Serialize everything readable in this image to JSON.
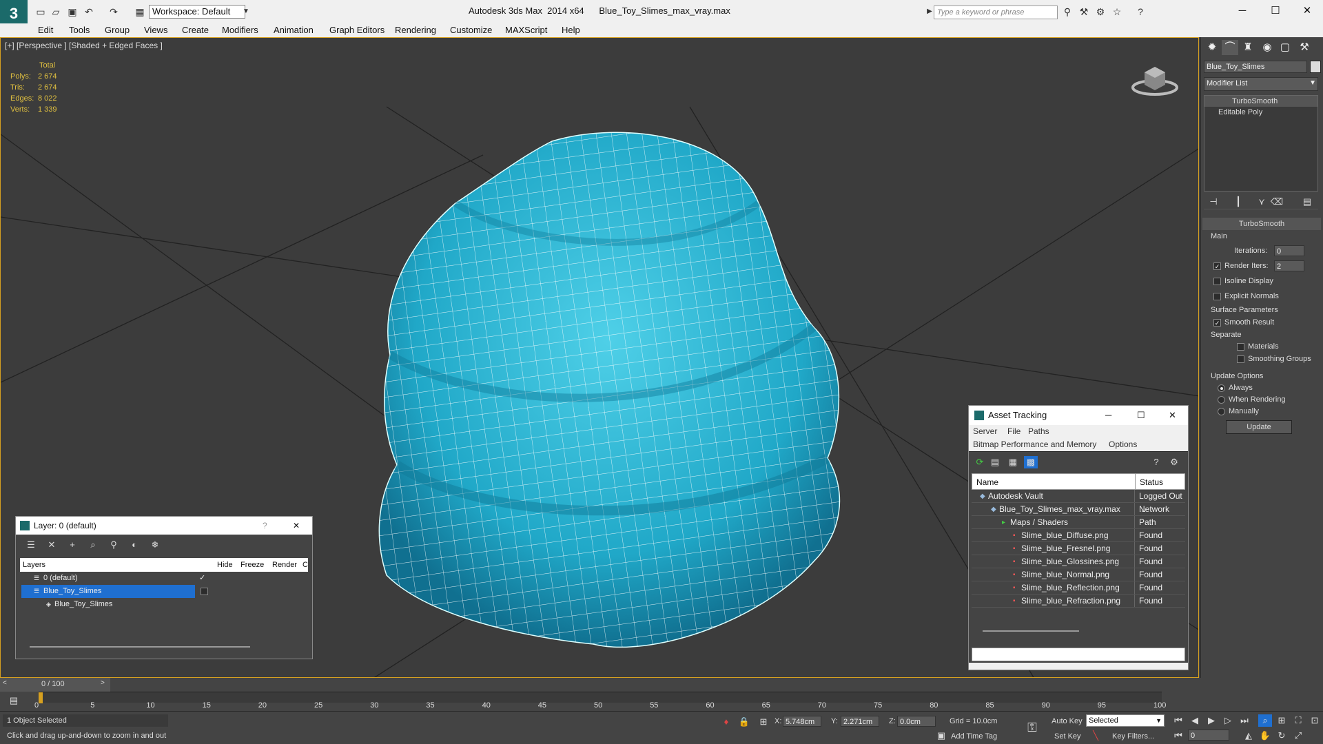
{
  "titlebar": {
    "app_title": "Autodesk 3ds Max  2014 x64",
    "file_name": "Blue_Toy_Slimes_max_vray.max",
    "workspace_label": "Workspace: Default",
    "search_placeholder": "Type a keyword or phrase"
  },
  "menu": [
    "Edit",
    "Tools",
    "Group",
    "Views",
    "Create",
    "Modifiers",
    "Animation",
    "Graph Editors",
    "Rendering",
    "Customize",
    "MAXScript",
    "Help"
  ],
  "viewport": {
    "label": "[+] [Perspective ] [Shaded + Edged Faces ]",
    "stats_header": "Total",
    "stats": [
      {
        "label": "Polys:",
        "value": "2 674"
      },
      {
        "label": "Tris:",
        "value": "2 674"
      },
      {
        "label": "Edges:",
        "value": "8 022"
      },
      {
        "label": "Verts:",
        "value": "1 339"
      }
    ],
    "mesh_color": "#2ab4d0"
  },
  "command_panel": {
    "object_name": "Blue_Toy_Slimes",
    "modifier_list_label": "Modifier List",
    "stack": [
      "TurboSmooth",
      "Editable Poly"
    ],
    "rollout_title": "TurboSmooth",
    "main_label": "Main",
    "iterations_label": "Iterations:",
    "iterations_value": "0",
    "render_iters_label": "Render Iters:",
    "render_iters_value": "2",
    "isoline_label": "Isoline Display",
    "explicit_normals_label": "Explicit Normals",
    "surface_params_label": "Surface Parameters",
    "smooth_result_label": "Smooth Result",
    "separate_label": "Separate",
    "materials_label": "Materials",
    "smoothing_groups_label": "Smoothing Groups",
    "update_options_label": "Update Options",
    "always_label": "Always",
    "when_rendering_label": "When Rendering",
    "manually_label": "Manually",
    "update_button": "Update"
  },
  "asset_tracking": {
    "title": "Asset Tracking",
    "menu1": [
      "Server",
      "File",
      "Paths"
    ],
    "menu2": [
      "Bitmap Performance and Memory",
      "Options"
    ],
    "col_name": "Name",
    "col_status": "Status",
    "rows": [
      {
        "name": "Autodesk Vault",
        "status": "Logged Out ...",
        "indent": 1
      },
      {
        "name": "Blue_Toy_Slimes_max_vray.max",
        "status": "Network Path",
        "indent": 2
      },
      {
        "name": "Maps / Shaders",
        "status": "",
        "indent": 3
      },
      {
        "name": "Slime_blue_Diffuse.png",
        "status": "Found",
        "indent": 4
      },
      {
        "name": "Slime_blue_Fresnel.png",
        "status": "Found",
        "indent": 4
      },
      {
        "name": "Slime_blue_Glossines.png",
        "status": "Found",
        "indent": 4
      },
      {
        "name": "Slime_blue_Normal.png",
        "status": "Found",
        "indent": 4
      },
      {
        "name": "Slime_blue_Reflection.png",
        "status": "Found",
        "indent": 4
      },
      {
        "name": "Slime_blue_Refraction.png",
        "status": "Found",
        "indent": 4
      }
    ]
  },
  "layer_dialog": {
    "title": "Layer: 0 (default)",
    "col_layers": "Layers",
    "col_hide": "Hide",
    "col_freeze": "Freeze",
    "col_render": "Render",
    "col_c": "C",
    "rows": [
      {
        "name": "0 (default)"
      },
      {
        "name": "Blue_Toy_Slimes"
      },
      {
        "name": "Blue_Toy_Slimes"
      }
    ]
  },
  "timeline": {
    "frame_label": "0 / 100",
    "ticks": [
      "0",
      "5",
      "10",
      "15",
      "20",
      "25",
      "30",
      "35",
      "40",
      "45",
      "50",
      "55",
      "60",
      "65",
      "70",
      "75",
      "80",
      "85",
      "90",
      "95",
      "100"
    ]
  },
  "status": {
    "selection": "1 Object Selected",
    "prompt": "Click and drag up-and-down to zoom in and out",
    "x_label": "X:",
    "x_value": "5.748cm",
    "y_label": "Y:",
    "y_value": "2.271cm",
    "z_label": "Z:",
    "z_value": "0.0cm",
    "grid": "Grid = 10.0cm",
    "auto_key": "Auto Key",
    "set_key": "Set Key",
    "selected_value": "Selected",
    "key_filters": "Key Filters...",
    "add_time_tag": "Add Time Tag",
    "frame_value": "0"
  },
  "colors": {
    "accent": "#d6a020",
    "selection": "#1f6fd0",
    "viewport_bg": "#3c3c3c"
  }
}
